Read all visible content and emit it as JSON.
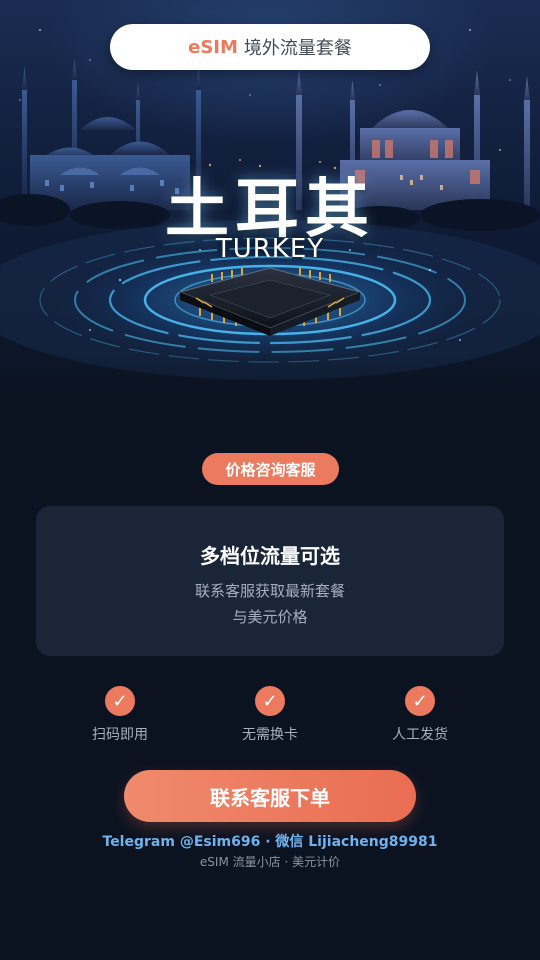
{
  "header": {
    "brand": "eSIM",
    "subtitle": "境外流量套餐"
  },
  "hero": {
    "title_cn": "土耳其",
    "title_en": "TURKEY"
  },
  "consult_label": "价格咨询客服",
  "card": {
    "title": "多档位流量可选",
    "line1": "联系客服获取最新套餐",
    "line2": "与美元价格"
  },
  "features": [
    {
      "icon": "check-icon",
      "label": "扫码即用"
    },
    {
      "icon": "check-icon",
      "label": "无需换卡"
    },
    {
      "icon": "check-icon",
      "label": "人工发货"
    }
  ],
  "cta_label": "联系客服下单",
  "contact_line": "Telegram @Esim696 · 微信 Lijiacheng89981",
  "footer_note": "eSIM 流量小店 · 美元计价",
  "colors": {
    "accent": "#ec7a5e",
    "background": "#0c1320",
    "card": "#1b2538",
    "contact_blue": "#6fb3ee"
  }
}
